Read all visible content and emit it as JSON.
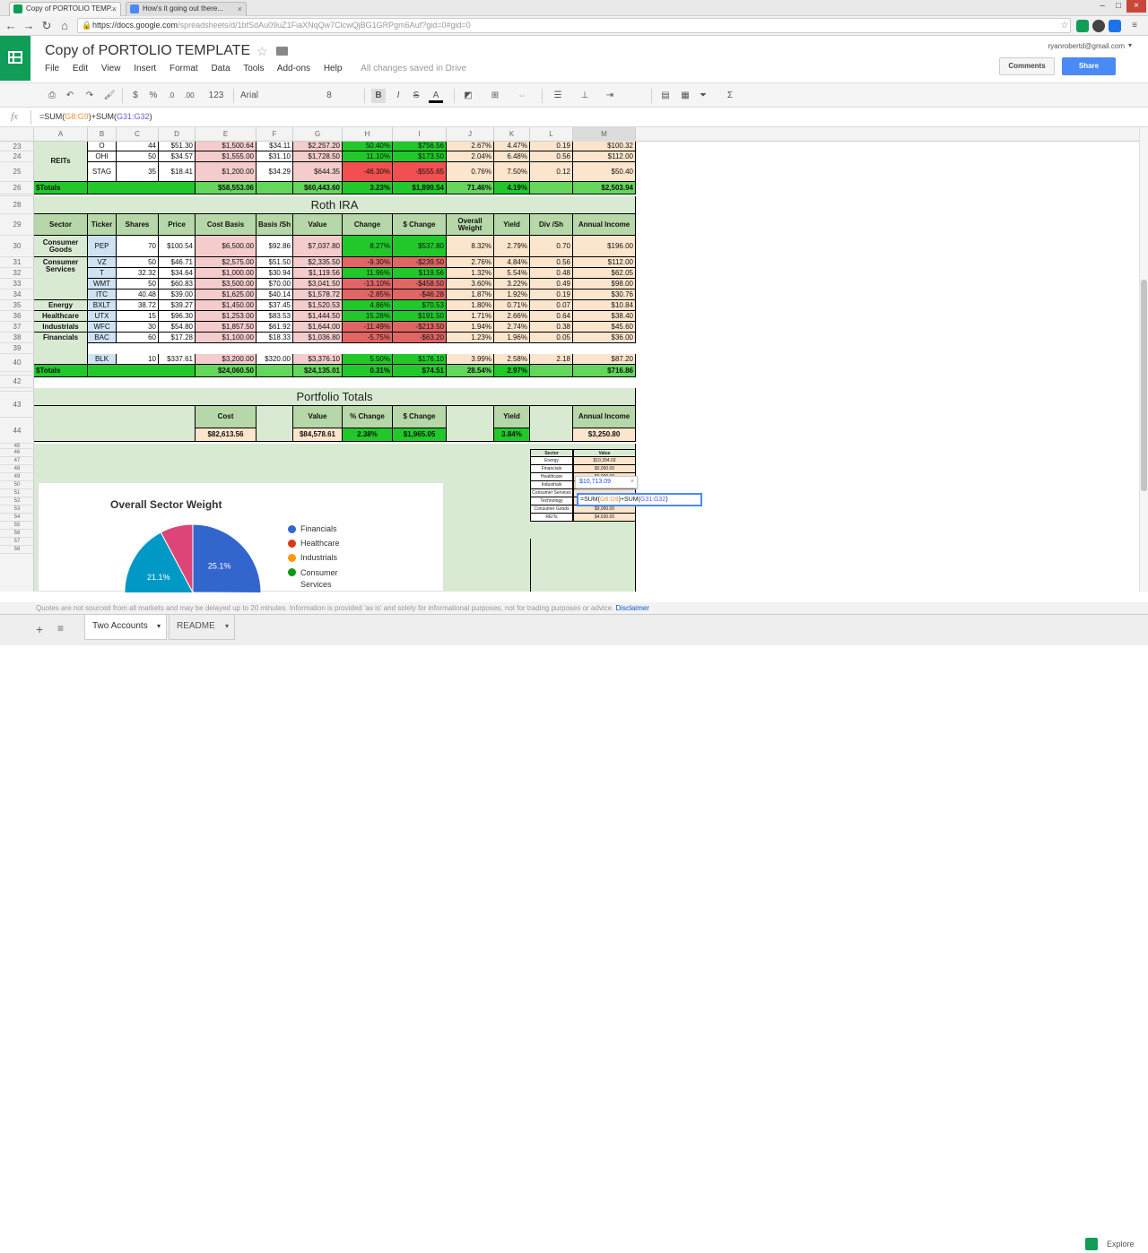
{
  "browser": {
    "tabs": [
      {
        "title": "Copy of PORTOLIO TEMP..."
      },
      {
        "title": "How's it going out there..."
      }
    ],
    "url_host": "https://docs.google.com",
    "url_path": "/spreadsheets/d/1bfSdAu09uZ1FiaXNqQw7ClcwQjBG1GRPgm6Auf?gid=0#gid=0"
  },
  "doc": {
    "title": "Copy of PORTOLIO TEMPLATE",
    "account": "ryanrobertd@gmail.com",
    "menu": [
      "File",
      "Edit",
      "View",
      "Insert",
      "Format",
      "Data",
      "Tools",
      "Add-ons",
      "Help"
    ],
    "save_status": "All changes saved in Drive",
    "comments_label": "Comments",
    "share_label": "Share"
  },
  "toolbar": {
    "zoom": "123",
    "font": "Arial",
    "font_size": "8",
    "bold": "B",
    "italic": "I",
    "strike": "S",
    "textcolor": "A",
    "sum": "Σ",
    "currency": "$",
    "percent": "%",
    "dec_less": ".0",
    "dec_more": ".00"
  },
  "formula": {
    "label": "fx",
    "pre": "=SUM(",
    "ref1": "G8:G9",
    "mid": ")+SUM(",
    "ref2": "G31:G32",
    "post": ")"
  },
  "columns": [
    "A",
    "B",
    "C",
    "D",
    "E",
    "F",
    "G",
    "H",
    "I",
    "J",
    "K",
    "L",
    "M"
  ],
  "rows": [
    "23",
    "24",
    "25",
    "26",
    "28",
    "29",
    "30",
    "31",
    "32",
    "33",
    "34",
    "35",
    "36",
    "37",
    "38",
    "39",
    "40",
    "42",
    "43",
    "44",
    "45",
    "46",
    "47",
    "48",
    "49",
    "50",
    "51",
    "52",
    "53",
    "54",
    "55",
    "56",
    "57",
    "58"
  ],
  "reits": {
    "sector": "REITs",
    "rows": [
      [
        "O",
        "44",
        "$51.30",
        "$1,500.64",
        "$34.11",
        "$2,257.20",
        "50.40%",
        "$756.56",
        "2.67%",
        "4.47%",
        "0.19",
        "$100.32"
      ],
      [
        "OHI",
        "50",
        "$34.57",
        "$1,555.00",
        "$31.10",
        "$1,728.50",
        "11.10%",
        "$173.50",
        "2.04%",
        "6.48%",
        "0.56",
        "$112.00"
      ],
      [
        "STAG",
        "35",
        "$18.41",
        "$1,200.00",
        "$34.29",
        "$644.35",
        "-46.30%",
        "-$555.65",
        "0.76%",
        "7.50%",
        "0.12",
        "$50.40"
      ]
    ],
    "totals": [
      "$Totals",
      "$58,553.06",
      "$60,443.60",
      "3.23%",
      "$1,890.54",
      "71.46%",
      "4.19%",
      "$2,503.94"
    ]
  },
  "roth": {
    "title": "Roth IRA",
    "headers": [
      "Sector",
      "Ticker",
      "Shares",
      "Price",
      "Cost Basis",
      "Basis /Sh",
      "Value",
      "Change",
      "$ Change",
      "Overall Weight",
      "Yield",
      "Div /Sh",
      "Annual Income"
    ],
    "sectors": [
      "Consumer Goods",
      "Consumer Services",
      "Energy",
      "Healthcare",
      "Industrials",
      "Financials"
    ],
    "rows": [
      [
        "PEP",
        "70",
        "$100.54",
        "$6,500.00",
        "$92.86",
        "$7,037.80",
        "8.27%",
        "$537.80",
        "8.32%",
        "2.79%",
        "0.70",
        "$196.00"
      ],
      [
        "VZ",
        "50",
        "$46.71",
        "$2,575.00",
        "$51.50",
        "$2,335.50",
        "-9.30%",
        "-$239.50",
        "2.76%",
        "4.84%",
        "0.56",
        "$112.00"
      ],
      [
        "T",
        "32.32",
        "$34.64",
        "$1,000.00",
        "$30.94",
        "$1,119.56",
        "11.96%",
        "$119.56",
        "1.32%",
        "5.54%",
        "0.48",
        "$62.05"
      ],
      [
        "WMT",
        "50",
        "$60.83",
        "$3,500.00",
        "$70.00",
        "$3,041.50",
        "-13.10%",
        "-$458.50",
        "3.60%",
        "3.22%",
        "0.49",
        "$98.00"
      ],
      [
        "ITC",
        "40.48",
        "$39.00",
        "$1,625.00",
        "$40.14",
        "$1,578.72",
        "-2.85%",
        "-$46.28",
        "1.87%",
        "1.92%",
        "0.19",
        "$30.76"
      ],
      [
        "BXLT",
        "38.72",
        "$39.27",
        "$1,450.00",
        "$37.45",
        "$1,520.53",
        "4.86%",
        "$70.53",
        "1.80%",
        "0.71%",
        "0.07",
        "$10.84"
      ],
      [
        "UTX",
        "15",
        "$96.30",
        "$1,253.00",
        "$83.53",
        "$1,444.50",
        "15.28%",
        "$191.50",
        "1.71%",
        "2.66%",
        "0.64",
        "$38.40"
      ],
      [
        "WFC",
        "30",
        "$54.80",
        "$1,857.50",
        "$61.92",
        "$1,644.00",
        "-11.49%",
        "-$213.50",
        "1.94%",
        "2.74%",
        "0.38",
        "$45.60"
      ],
      [
        "BAC",
        "60",
        "$17.28",
        "$1,100.00",
        "$18.33",
        "$1,036.80",
        "-5.75%",
        "-$63.20",
        "1.23%",
        "1.96%",
        "0.05",
        "$36.00"
      ],
      [
        "BLK",
        "10",
        "$337.61",
        "$3,200.00",
        "$320.00",
        "$3,376.10",
        "5.50%",
        "$176.10",
        "3.99%",
        "2.58%",
        "2.18",
        "$87.20"
      ]
    ],
    "totals": [
      "$Totals",
      "$24,060.50",
      "$24,135.01",
      "0.31%",
      "$74.51",
      "28.54%",
      "2.97%",
      "$716.86"
    ]
  },
  "portfolio": {
    "title": "Portfolio Totals",
    "headers": [
      "Cost",
      "Value",
      "% Change",
      "$ Change",
      "Yield",
      "Annual Income"
    ],
    "values": [
      "$82,613.56",
      "$84,578.61",
      "2.38%",
      "$1,965.05",
      "3.84%",
      "$3,250.80"
    ]
  },
  "mini_table": {
    "headers": [
      "Sector",
      "Value"
    ],
    "rows": [
      [
        "Energy",
        "$10,394.03"
      ],
      [
        "Financials",
        "$0,000.00"
      ],
      [
        "Healthcare",
        "$0,000.00"
      ],
      [
        "Industrials",
        ""
      ],
      [
        "Consumer Services",
        ""
      ],
      [
        "Technology",
        "$0,000.00"
      ],
      [
        "Consumer Goods",
        "$9,000.00"
      ],
      [
        "REITs",
        "$4,630.05"
      ]
    ]
  },
  "tooltip": {
    "value": "$10,713.09",
    "close": "×"
  },
  "chart_data": {
    "type": "pie",
    "title": "Overall Sector Weight",
    "labels": [
      "Financials",
      "Healthcare",
      "Industrials",
      "Consumer Services"
    ],
    "values_visible_percent": [
      25.1,
      21.1
    ],
    "colors": [
      "#3366cc",
      "#dc3912",
      "#ff9900",
      "#109618"
    ],
    "slice_colors_visible": {
      "blue": "#3366cc",
      "teal": "#0099c6",
      "pink": "#dd4477"
    }
  },
  "footer": {
    "note": "Quotes are not sourced from all markets and may be delayed up to 20 minutes. Information is provided 'as is' and solely for informational purposes, not for trading purposes or advice.",
    "link": "Disclaimer"
  },
  "sheet_tabs": [
    {
      "label": "Two Accounts"
    },
    {
      "label": "README"
    }
  ],
  "explore_label": "Explore"
}
